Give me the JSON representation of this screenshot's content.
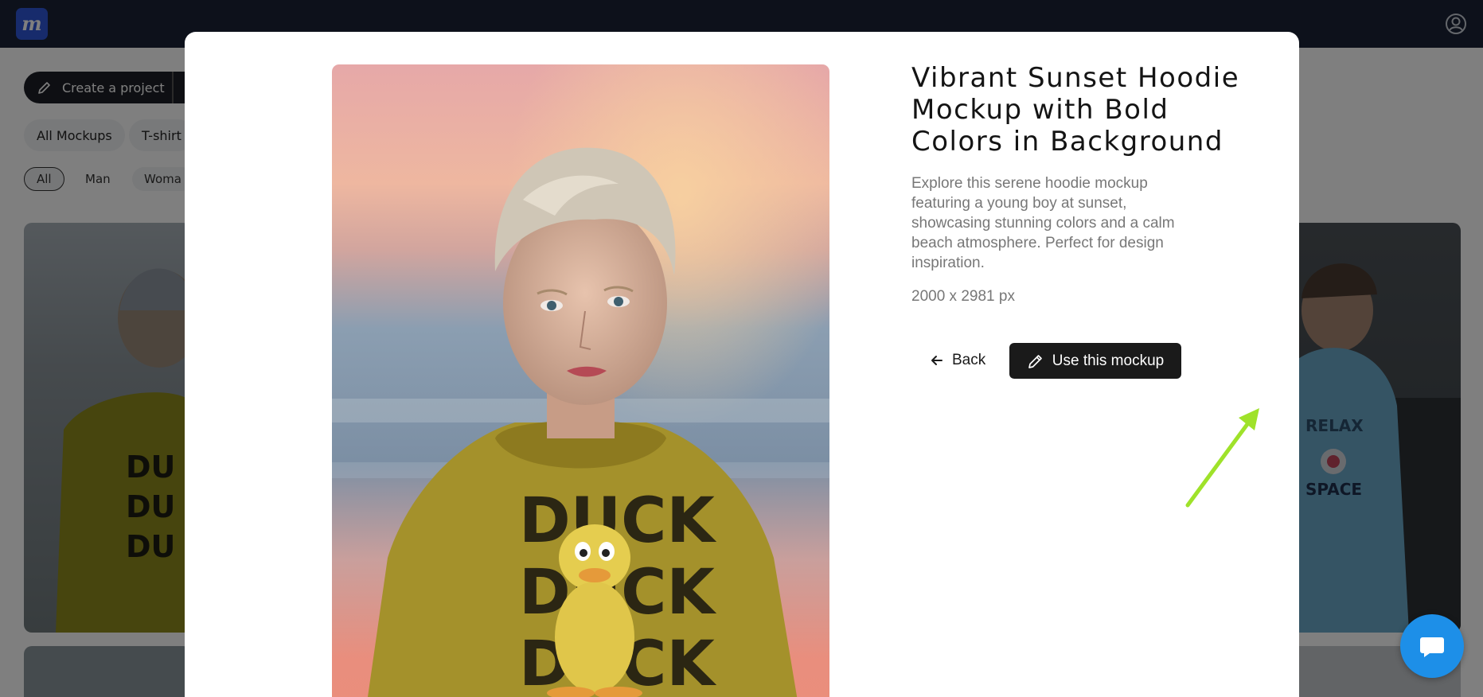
{
  "app": {
    "logo_letter": "m",
    "icons": {
      "logo": "brand-logo",
      "account": "account-circle-icon",
      "chat": "chat-bubble-icon",
      "pencil": "pencil-icon",
      "back": "arrow-left-icon"
    },
    "colors": {
      "topbar": "#1a2236",
      "logo_bg": "#2f56d8",
      "primary_button": "#1a1a1a",
      "chat": "#1d8fe8",
      "annotation_arrow": "#9fe22a"
    }
  },
  "toolbar": {
    "create_project_label": "Create a project"
  },
  "categories": [
    "All Mockups",
    "T-shirt"
  ],
  "filters": [
    "All",
    "Man",
    "Woma"
  ],
  "modal": {
    "title": "Vibrant Sunset Hoodie Mockup with Bold Colors in Background",
    "description": "Explore this serene hoodie mockup featuring a young boy at sunset, showcasing stunning colors and a calm beach atmosphere. Perfect for design inspiration.",
    "dimensions": "2000 x 2981 px",
    "back_label": "Back",
    "use_label": "Use this mockup"
  },
  "mockup_print": {
    "lines": [
      "DUCK",
      "DUCK",
      "DUCK"
    ]
  },
  "background_print": {
    "left_lines": [
      "DU",
      "DU",
      "DU"
    ],
    "right_text": [
      "RELAX",
      "SPACE"
    ]
  }
}
